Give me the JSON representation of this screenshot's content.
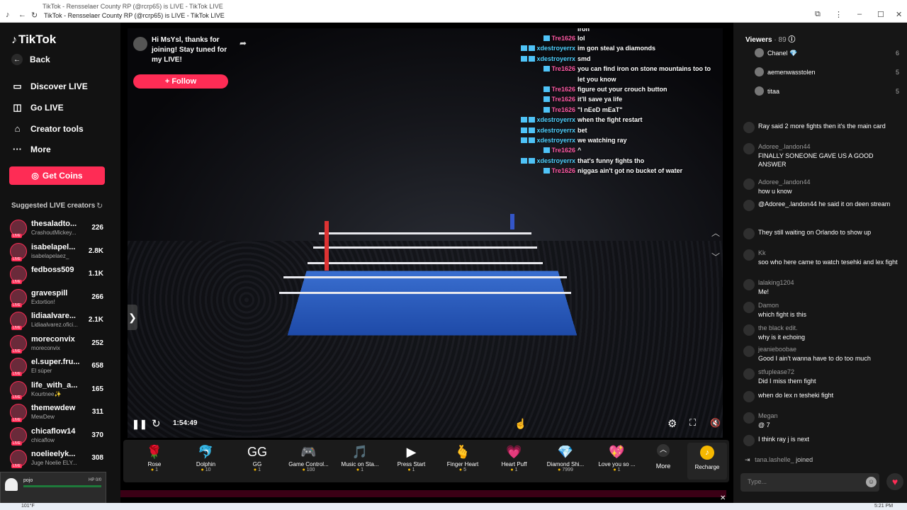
{
  "browser": {
    "tab_title": "TikTok - Rensselaer County RP (@rcrp65) is LIVE - TikTok LIVE",
    "address": "TikTok - Rensselaer County RP (@rcrp65) is LIVE - TikTok LIVE"
  },
  "sidebar": {
    "logo": "TikTok",
    "back": "Back",
    "nav": [
      {
        "label": "Discover LIVE",
        "icon": "discover-icon"
      },
      {
        "label": "Go LIVE",
        "icon": "camera-icon"
      },
      {
        "label": "Creator tools",
        "icon": "home-icon"
      },
      {
        "label": "More",
        "icon": "more-dots-icon"
      }
    ],
    "coins_button": "Get Coins",
    "suggested_title": "Suggested LIVE creators",
    "creators": [
      {
        "name": "thesaladto...",
        "sub": "CrashoutMickey...",
        "count": "226"
      },
      {
        "name": "isabelapel...",
        "sub": "isabelapelaez_",
        "count": "2.8K"
      },
      {
        "name": "fedboss509",
        "sub": "",
        "count": "1.1K"
      },
      {
        "name": "gravespill",
        "sub": "Extortion!",
        "count": "266"
      },
      {
        "name": "lidiaalvare...",
        "sub": "Lidiaalvarez.ofici...",
        "count": "2.1K"
      },
      {
        "name": "moreconvix",
        "sub": "moreconvix",
        "count": "252"
      },
      {
        "name": "el.super.fru...",
        "sub": "El súper",
        "count": "658"
      },
      {
        "name": "life_with_a...",
        "sub": "Kourtnee✨",
        "count": "165"
      },
      {
        "name": "themewdew",
        "sub": "MewDew",
        "count": "311"
      },
      {
        "name": "chicaflow14",
        "sub": "chicaflow",
        "count": "370"
      },
      {
        "name": "noelieelyk...",
        "sub": "Juge Noelie ELY...",
        "count": "308"
      }
    ],
    "mini_player": {
      "name": "pojo",
      "hp": "HP 0/0"
    }
  },
  "stream": {
    "host_message": "Hi MsYsl, thanks for joining! Stay tuned for my LIVE!",
    "follow_button": "+ Follow",
    "time": "1:54:49",
    "overlay_top": "iron",
    "overlay_chat": [
      {
        "user": "Tre1626",
        "text": "lol",
        "color": "r",
        "badges": 1
      },
      {
        "user": "xdestroyerrx",
        "text": "im gon steal ya diamonds",
        "color": "b",
        "badges": 2
      },
      {
        "user": "xdestroyerrx",
        "text": "smd",
        "color": "b",
        "badges": 2
      },
      {
        "user": "Tre1626",
        "text": "you can find iron on stone mountains too to let you know",
        "color": "r",
        "badges": 1
      },
      {
        "user": "Tre1626",
        "text": "figure out your crouch button",
        "color": "r",
        "badges": 1
      },
      {
        "user": "Tre1626",
        "text": "it'll save ya life",
        "color": "r",
        "badges": 1
      },
      {
        "user": "Tre1626",
        "text": "\"I nEeD mEaT\"",
        "color": "r",
        "badges": 1
      },
      {
        "user": "xdestroyerrx",
        "text": "when the fight restart",
        "color": "b",
        "badges": 2
      },
      {
        "user": "xdestroyerrx",
        "text": "bet",
        "color": "b",
        "badges": 2
      },
      {
        "user": "xdestroyerrx",
        "text": "we watching ray",
        "color": "b",
        "badges": 2
      },
      {
        "user": "Tre1626",
        "text": "^",
        "color": "r",
        "badges": 1
      },
      {
        "user": "xdestroyerrx",
        "text": "that's funny fights tho",
        "color": "b",
        "badges": 2
      },
      {
        "user": "Tre1626",
        "text": "niggas ain't got no bucket of water",
        "color": "r",
        "badges": 1
      }
    ],
    "gifts": [
      {
        "name": "Rose",
        "price": "1",
        "icon": "rose-icon",
        "glyph": "🌹"
      },
      {
        "name": "Dolphin",
        "price": "10",
        "icon": "dolphin-icon",
        "glyph": "🐬"
      },
      {
        "name": "GG",
        "price": "1",
        "icon": "gg-icon",
        "glyph": "GG"
      },
      {
        "name": "Game Control...",
        "price": "100",
        "icon": "gamepad-icon",
        "glyph": "🎮"
      },
      {
        "name": "Music on Sta...",
        "price": "1",
        "icon": "music-icon",
        "glyph": "🎵"
      },
      {
        "name": "Press Start",
        "price": "1",
        "icon": "press-start-icon",
        "glyph": "▶"
      },
      {
        "name": "Finger Heart",
        "price": "5",
        "icon": "finger-heart-icon",
        "glyph": "🫰"
      },
      {
        "name": "Heart Puff",
        "price": "1",
        "icon": "heart-puff-icon",
        "glyph": "💗"
      },
      {
        "name": "Diamond Shi...",
        "price": "7999",
        "icon": "diamond-icon",
        "glyph": "💎"
      },
      {
        "name": "Love you so ...",
        "price": "1",
        "icon": "love-icon",
        "glyph": "💖"
      }
    ],
    "more_label": "More",
    "recharge_label": "Recharge"
  },
  "chat": {
    "viewers_label": "Viewers",
    "viewers_count": "· 89",
    "viewers": [
      {
        "name": "Chanel 💎",
        "rank": "6"
      },
      {
        "name": "aemenwasstolen",
        "rank": "5"
      },
      {
        "name": "titaa",
        "rank": "5"
      }
    ],
    "messages": [
      {
        "user": "",
        "text": "Ray said 2 more fights then it's the main card"
      },
      {
        "user": "Adoree_.landon44",
        "text": "FINALLY SONEONE GAVE US A GOOD ANSWER"
      },
      {
        "user": "Adoree_.landon44",
        "text": "how u know"
      },
      {
        "user": "",
        "text": "@Adoree_.landon44 he said it on deen stream"
      },
      {
        "user": "",
        "text": "They still waiting on Orlando to show up"
      },
      {
        "user": "Kk",
        "text": "soo who here came to watch tesehki and lex fight"
      },
      {
        "user": "lalaking1204",
        "text": "Me!"
      },
      {
        "user": "Damon",
        "text": "which fight is this"
      },
      {
        "user": "the black edit.",
        "text": "why is it echoing"
      },
      {
        "user": "jeanieboobae",
        "text": "Good I ain't wanna have to do too much"
      },
      {
        "user": "stfuplease72",
        "text": "Did I miss them fight"
      },
      {
        "user": "",
        "text": "when do lex n tesheki fight"
      },
      {
        "user": "Megan",
        "text": "@ 7"
      },
      {
        "user": "",
        "text": "I think ray j is next"
      }
    ],
    "joined_user": "tana.lashelle_",
    "joined_text": "joined",
    "input_placeholder": "Type..."
  },
  "taskbar": {
    "weather": "101°F",
    "clock": "5:21 PM"
  }
}
